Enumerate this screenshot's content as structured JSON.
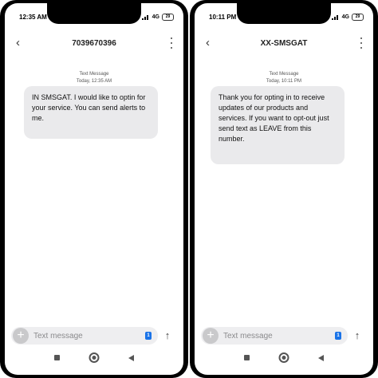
{
  "left": {
    "status_time": "12:35 AM",
    "network": "4G",
    "battery": "29",
    "contact_title": "7039670396",
    "message_type": "Text Message",
    "message_time": "Today, 12:35 AM",
    "message_text": "IN SMSGAT. I would like to optin for your service. You can send alerts to me.",
    "input_placeholder": "Text message",
    "sim_label": "1"
  },
  "right": {
    "status_time": "10:11 PM",
    "network": "4G",
    "battery": "29",
    "contact_title": "XX-SMSGAT",
    "message_type": "Text Message",
    "message_time": "Today, 10:11 PM",
    "message_text": "Thank you for opting in to receive updates of our products and services. If you want to opt-out just send text as LEAVE from this number.",
    "input_placeholder": "Text message",
    "sim_label": "1"
  },
  "icons": {
    "back": "back-arrow-icon",
    "more": "more-vert-icon",
    "add": "add-icon",
    "send": "send-arrow-icon",
    "sim": "sim-icon"
  },
  "colors": {
    "bubble": "#eaeaec",
    "sim_badge": "#1a73e8",
    "frame": "#000000"
  }
}
